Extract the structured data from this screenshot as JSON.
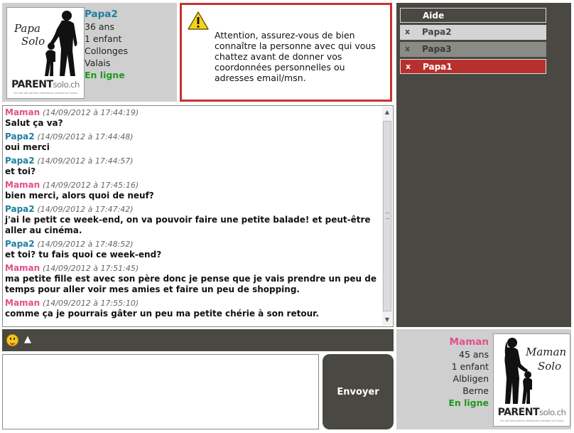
{
  "profile_top": {
    "brand": "PARENT",
    "brand_suffix": "solo.ch",
    "tagline": "1er site des parents célibataires résidant en Suisse",
    "script_line1": "Papa",
    "script_line2": "Solo",
    "name": "Papa2",
    "age": "36 ans",
    "children": "1 enfant",
    "city": "Collonges",
    "region": "Valais",
    "status": "En ligne"
  },
  "warning": {
    "icon": "warning-icon",
    "text": "Attention, assurez-vous de bien connaître la personne avec qui vous chattez avant de donner vos coordonnées personnelles ou adresses email/msn."
  },
  "side": {
    "help_label": "Aide",
    "tabs": [
      {
        "close": "x",
        "label": "Papa2"
      },
      {
        "close": "x",
        "label": "Papa3"
      },
      {
        "close": "x",
        "label": "Papa1"
      }
    ]
  },
  "chat": {
    "messages": [
      {
        "author": "Maman",
        "time": "(14/09/2012 à 17:44:19)",
        "text": "Salut ça va?"
      },
      {
        "author": "Papa2",
        "time": "(14/09/2012 à 17:44:48)",
        "text": "oui merci"
      },
      {
        "author": "Papa2",
        "time": "(14/09/2012 à 17:44:57)",
        "text": "et toi?"
      },
      {
        "author": "Maman",
        "time": "(14/09/2012 à 17:45:16)",
        "text": "bien merci, alors quoi de neuf?"
      },
      {
        "author": "Papa2",
        "time": "(14/09/2012 à 17:47:42)",
        "text": "j'ai le petit ce week-end, on va pouvoir faire une petite balade! et peut-être aller au cinéma."
      },
      {
        "author": "Papa2",
        "time": "(14/09/2012 à 17:48:52)",
        "text": "et toi? tu fais quoi ce week-end?"
      },
      {
        "author": "Maman",
        "time": "(14/09/2012 à 17:51:45)",
        "text": "ma petite fille est avec son père donc je pense que je vais prendre un peu de temps pour aller voir mes amies et faire un peu de shopping."
      },
      {
        "author": "Maman",
        "time": "(14/09/2012 à 17:55:10)",
        "text": "comme ça je pourrais gâter un peu ma petite chérie à son retour."
      }
    ]
  },
  "toolbar": {
    "emoji_icon": "smiley-icon",
    "up_arrow": "▲"
  },
  "input": {
    "value": "",
    "send_label": "Envoyer"
  },
  "profile_bottom": {
    "brand": "PARENT",
    "brand_suffix": "solo.ch",
    "tagline": "1er site des parents célibataires résidant en Suisse",
    "script_line1": "Maman",
    "script_line2": "Solo",
    "name": "Maman",
    "age": "45 ans",
    "children": "1 enfant",
    "city": "Albligen",
    "region": "Berne",
    "status": "En ligne"
  },
  "colors": {
    "panel_dark": "#4a4842",
    "panel_light": "#cfcfcf",
    "warning_border": "#c8322f",
    "active_tab": "#b7302d",
    "maman_name": "#e0508a",
    "papa_name": "#1f7ea0",
    "online": "#1d9a1d"
  }
}
